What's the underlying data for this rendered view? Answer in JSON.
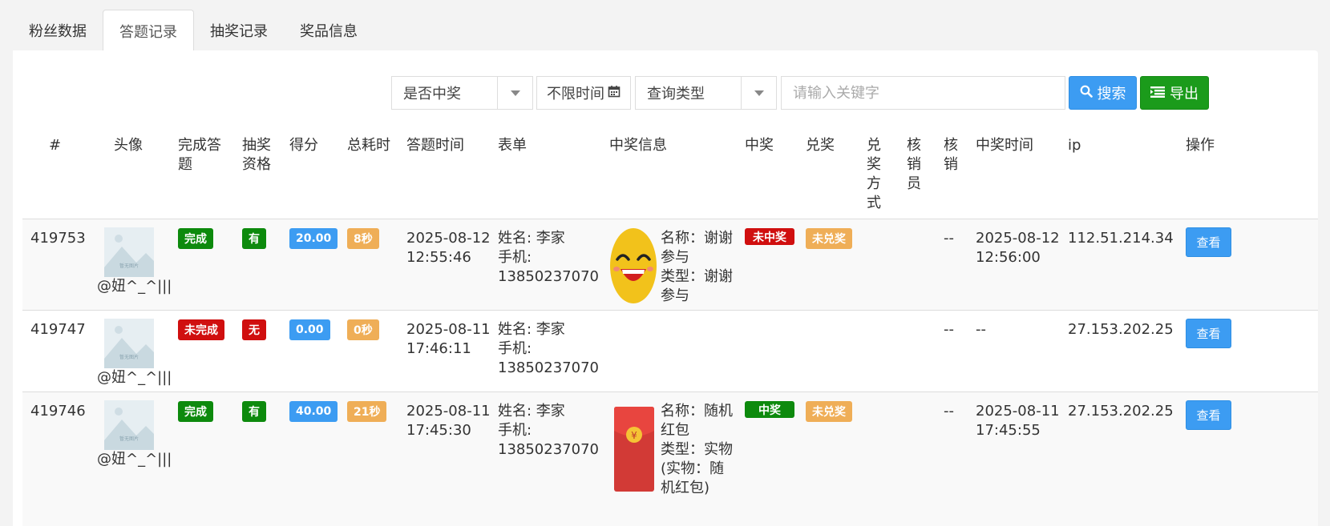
{
  "tabs": [
    {
      "label": "粉丝数据"
    },
    {
      "label": "答题记录"
    },
    {
      "label": "抽奖记录"
    },
    {
      "label": "奖品信息"
    }
  ],
  "toolbar": {
    "prize_filter": "是否中奖",
    "time_filter": "不限时间",
    "query_type": "查询类型",
    "keyword_placeholder": "请输入关键字",
    "search_label": "搜索",
    "export_label": "导出"
  },
  "columns": {
    "id": "#",
    "avatar": "头像",
    "complete": "完成答题",
    "eligible": "抽奖资格",
    "score": "得分",
    "duration": "总耗时",
    "answer_time": "答题时间",
    "form": "表单",
    "prize_info": "中奖信息",
    "won": "中奖",
    "redeem": "兑奖",
    "redeem_method": "兑奖方式",
    "verifier": "核销员",
    "verify": "核销",
    "win_time": "中奖时间",
    "ip": "ip",
    "actions": "操作"
  },
  "rows": [
    {
      "id": "419753",
      "nickname": "@妞^_^|||",
      "avatar_caption": "暂无图片",
      "complete": "完成",
      "eligible": "有",
      "score": "20.00",
      "duration": "8秒",
      "answer_date": "2025-08-12",
      "answer_clock": "12:55:46",
      "form_name": "姓名: 李家",
      "form_phone_label": "手机:",
      "form_phone": "13850237070",
      "prize_lines": [
        "名称：谢谢",
        "参与",
        "类型：谢谢",
        "参与"
      ],
      "won": "未中奖",
      "redeem": "未兑奖",
      "verify": "--",
      "win_date": "2025-08-12",
      "win_clock": "12:56:00",
      "ip": "112.51.214.34",
      "action": "查看"
    },
    {
      "id": "419747",
      "nickname": "@妞^_^|||",
      "avatar_caption": "暂无图片",
      "complete": "未完成",
      "eligible": "无",
      "score": "0.00",
      "duration": "0秒",
      "answer_date": "2025-08-11",
      "answer_clock": "17:46:11",
      "form_name": "姓名: 李家",
      "form_phone_label": "手机:",
      "form_phone": "13850237070",
      "verify": "--",
      "win_time": "--",
      "ip": "27.153.202.25",
      "action": "查看"
    },
    {
      "id": "419746",
      "nickname": "@妞^_^|||",
      "avatar_caption": "暂无图片",
      "complete": "完成",
      "eligible": "有",
      "score": "40.00",
      "duration": "21秒",
      "answer_date": "2025-08-11",
      "answer_clock": "17:45:30",
      "form_name": "姓名: 李家",
      "form_phone_label": "手机:",
      "form_phone": "13850237070",
      "prize_lines": [
        "名称：随机",
        "红包",
        "类型：实物",
        "(实物：随",
        "机红包)"
      ],
      "won": "中奖",
      "redeem": "未兑奖",
      "verify": "--",
      "win_date": "2025-08-11",
      "win_clock": "17:45:55",
      "ip": "27.153.202.25",
      "action": "查看"
    }
  ],
  "colors": {
    "blue": "#3c9cf2",
    "green": "#0d8a0d",
    "red": "#d00f0f",
    "orange": "#efae57"
  }
}
